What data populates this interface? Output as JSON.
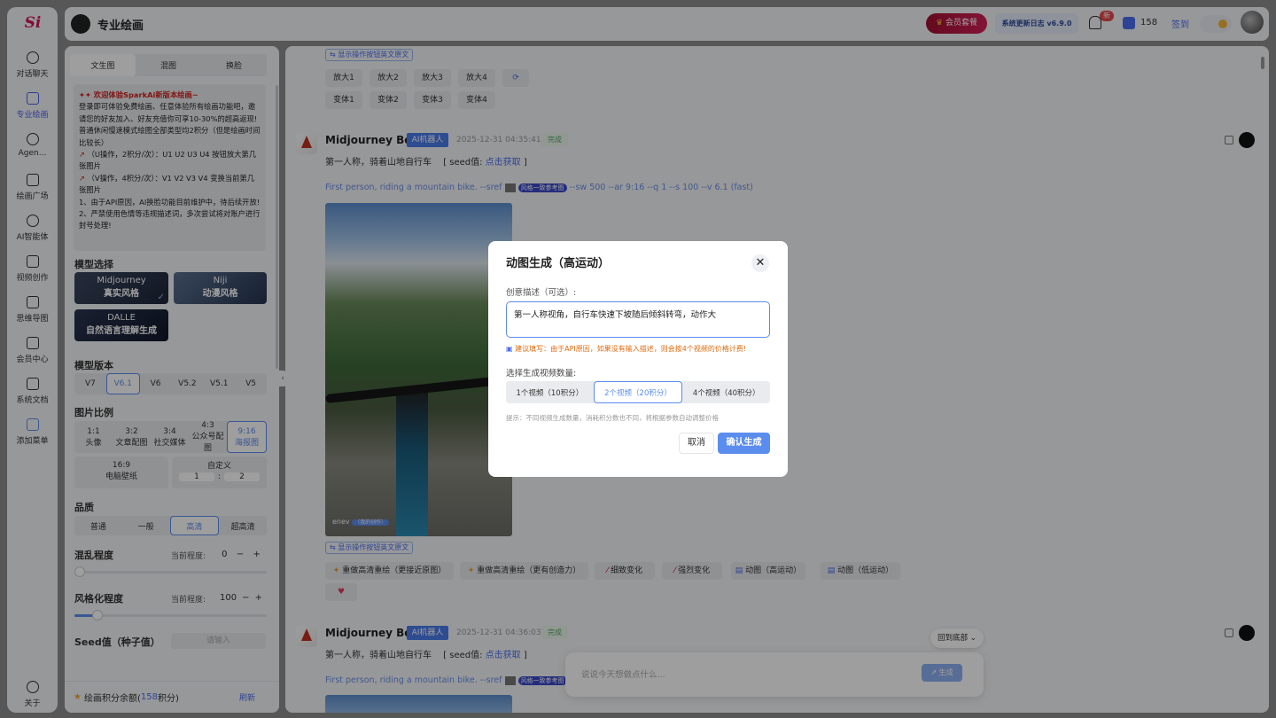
{
  "app": {
    "logo_text": "Si",
    "title": "专业绘画"
  },
  "nav": {
    "items": [
      {
        "label": "对话聊天",
        "icon": "chat-icon"
      },
      {
        "label": "专业绘画",
        "icon": "paint-icon"
      },
      {
        "label": "Agen...",
        "icon": "agent-icon"
      },
      {
        "label": "绘画广场",
        "icon": "gallery-icon"
      },
      {
        "label": "AI智能体",
        "icon": "ai-icon"
      },
      {
        "label": "视频创作",
        "icon": "video-icon"
      },
      {
        "label": "思维导图",
        "icon": "mindmap-icon"
      },
      {
        "label": "会员中心",
        "icon": "cart-icon"
      },
      {
        "label": "系统文档",
        "icon": "doc-icon"
      },
      {
        "label": "添加菜单",
        "icon": "grid-icon"
      }
    ],
    "about": "关于"
  },
  "header": {
    "vip": "会员套餐",
    "changelog": "系统更新日志 v6.9.0",
    "bell_badge": "新",
    "points": "158",
    "signin": "签到"
  },
  "panel": {
    "tabs": [
      "文生图",
      "混图",
      "换脸"
    ],
    "notice": {
      "title": "欢迎体验SparkAi新版本绘画~",
      "lines": [
        "登录即可体验免费绘画、任意体验所有绘画功能吧，邀请您的好友加入、好友充值你可享10-30%的超高返现!",
        "普通休闲慢速模式绘图全部类型均2积分（但是绘画时间比较长）",
        "（U操作，2积分/次）：U1 U2 U3 U4 按钮放大第几张图片",
        "（V操作，4积分/次）：V1 V2 V3 V4 变换当前第几张图片",
        "1、由于API原因，AI换脸功能目前维护中，待后续开放!",
        "2、严禁使用色情等违规描述词，多次尝试将对账户进行封号处理!"
      ]
    },
    "model_label": "模型选择",
    "models": [
      {
        "name": "Midjourney",
        "desc": "真实风格"
      },
      {
        "name": "Niji",
        "desc": "动漫风格"
      },
      {
        "name": "DALLE",
        "desc": "自然语言理解生成"
      }
    ],
    "version_label": "模型版本",
    "versions": [
      "V7",
      "V6.1",
      "V6",
      "V5.2",
      "V5.1",
      "V5"
    ],
    "ratio_label": "图片比例",
    "ratios": [
      {
        "r": "1:1",
        "d": "头像"
      },
      {
        "r": "3:2",
        "d": "文章配图"
      },
      {
        "r": "3:4",
        "d": "社交媒体"
      },
      {
        "r": "4:3",
        "d": "公众号配图"
      },
      {
        "r": "9:16",
        "d": "海报图"
      }
    ],
    "ratio_wide": {
      "r": "16:9",
      "d": "电脑壁纸"
    },
    "ratio_custom": {
      "label": "自定义",
      "w": "1",
      "sep": ":",
      "h": "2"
    },
    "quality_label": "品质",
    "qualities": [
      "普通",
      "一般",
      "高清",
      "超高清"
    ],
    "chaos_label": "混乱程度",
    "chaos_current_label": "当前程度:",
    "chaos_value": "0",
    "chaos_level": 0,
    "stylize_label": "风格化程度",
    "stylize_current_label": "当前程度:",
    "stylize_value": "100",
    "stylize_level": 0.12,
    "seed_label": "Seed值（种子值）",
    "seed_placeholder": "请输入",
    "balance_prefix": "绘画积分余额(",
    "balance_value": "158",
    "balance_suffix": "积分)",
    "refresh": "刷新"
  },
  "main": {
    "show_original": "显示操作按钮英文原文",
    "upscale": [
      "放大1",
      "放大2",
      "放大3",
      "放大4"
    ],
    "variations": [
      "变体1",
      "变体2",
      "变体3",
      "变体4"
    ],
    "messages": [
      {
        "bot": "Midjourney Bot",
        "tag": "AI机器人",
        "time": "2025-12-31 04:35:41",
        "status": "完成",
        "prompt_cn": "第一人称，骑着山地自行车",
        "seed_label": "[ seed值:",
        "seed_link": "点击获取",
        "seed_end": "]",
        "prompt_en": "First person, riding a mountain bike. --sref",
        "sref_badge": "风格一致参考图",
        "params": "--sw 500 --ar 9:16 --q 1 --s 100 --v 6.1  (fast)",
        "watermark": "enev",
        "watermark_tag": "（我的创作）"
      },
      {
        "bot": "Midjourney Bot",
        "tag": "AI机器人",
        "time": "2025-12-31 04:36:03",
        "status": "完成",
        "prompt_cn": "第一人称，骑着山地自行车",
        "seed_label": "[ seed值:",
        "seed_link": "点击获取",
        "seed_end": "]",
        "prompt_en": "First person, riding a mountain bike. --sref",
        "sref_badge": "风格一致参考图"
      }
    ],
    "actions": [
      "重做高清重绘（更接近原图）",
      "重做高清重绘（更有创造力）",
      "细致变化",
      "强烈变化",
      "动图（高运动）",
      "动图（低运动）"
    ],
    "back_bottom": "回到底部",
    "input_placeholder": "说说今天想做点什么...",
    "send": "生成"
  },
  "dialog": {
    "title": "动图生成（高运动）",
    "desc_label": "创意描述（可选）:",
    "desc_value": "第一人称视角，自行车快速下坡随后倾斜转弯，动作大",
    "warn": "建议填写：由于API原因，如果没有输入描述，则会按4个视频的价格计费!",
    "count_label": "选择生成视频数量:",
    "options": [
      "1个视频（10积分）",
      "2个视频（20积分）",
      "4个视频（40积分）"
    ],
    "hint": "提示：不同视频生成数量，消耗积分数也不同，将根据参数自动调整价格",
    "cancel": "取消",
    "confirm": "确认生成"
  },
  "colors": {
    "accent": "#5b8def",
    "brand_red": "#c0143c",
    "tag_blue": "#4a7bea",
    "status_green": "#5aa86a"
  }
}
